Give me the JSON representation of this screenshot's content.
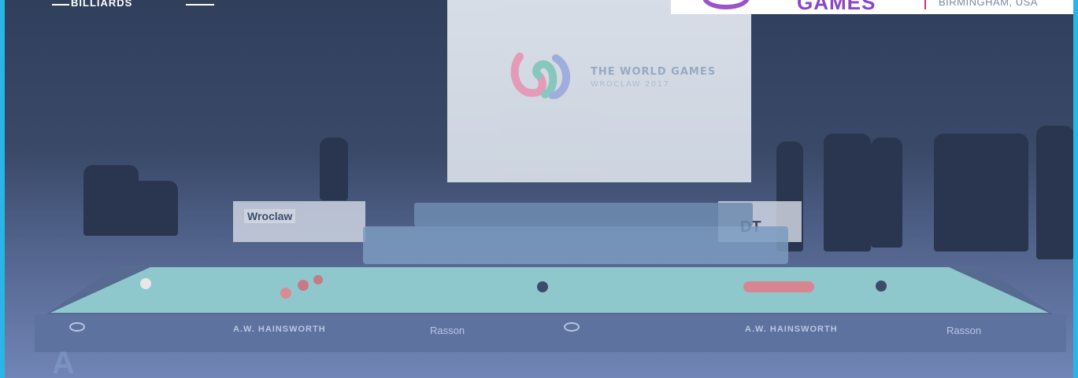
{
  "header": {
    "left_logo_text": "BILLIARDS",
    "right_logo_games": "GAMES",
    "right_logo_city": "BIRMINGHAM, USA"
  },
  "screen": {
    "title": "THE WORLD GAMES",
    "subtitle": "WROCLAW 2017"
  },
  "signage": {
    "wroclaw": "Wroclaw",
    "tdt": "DT"
  },
  "apron": {
    "brand1": "A.W. HAINSWORTH",
    "brand2": "Rasson",
    "brand3": "A.W. HAINSWORTH",
    "brand4": "Rasson"
  },
  "colors": {
    "frame": "#2bb4e6",
    "overlay": "#4f6088",
    "cloth": "#8fc8cc",
    "games_purple": "#8b46c4",
    "divider_red": "#c23a73"
  }
}
